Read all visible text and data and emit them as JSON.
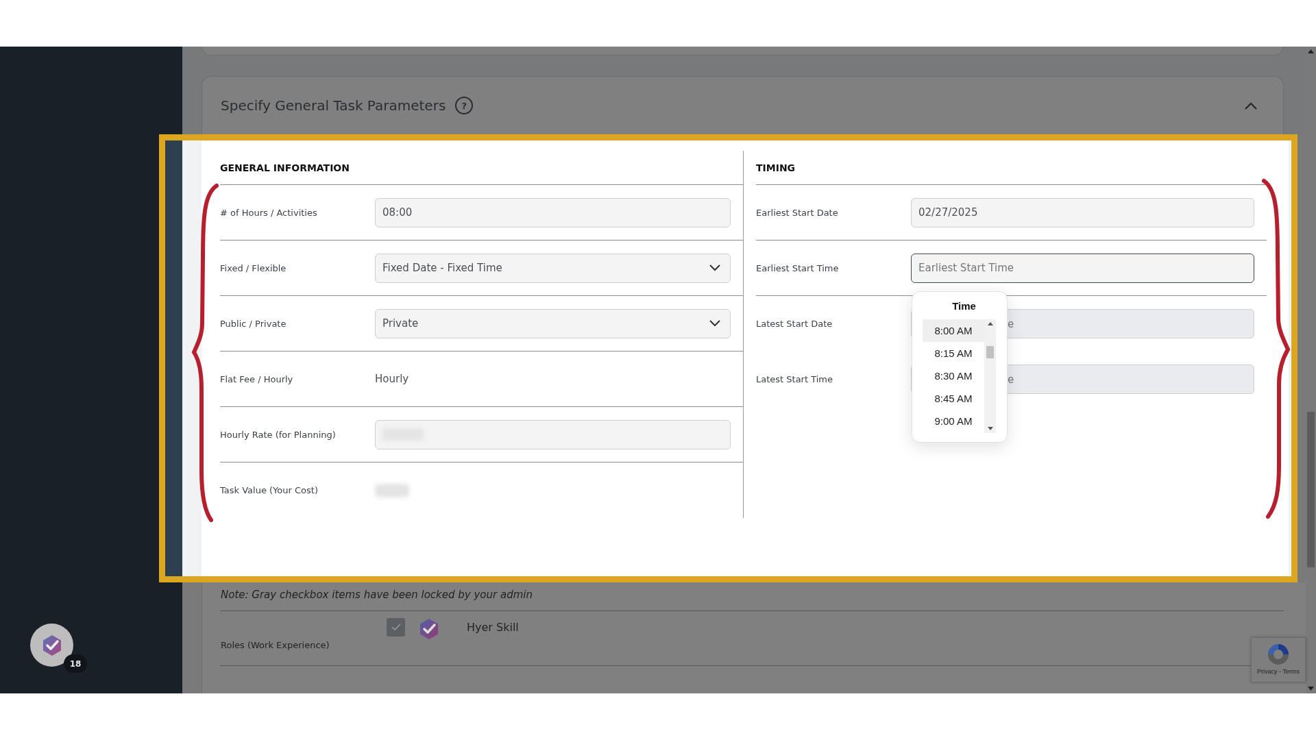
{
  "section": {
    "title": "Specify General Task Parameters",
    "help": "?",
    "expanded": true
  },
  "general": {
    "heading": "GENERAL INFORMATION",
    "rows": [
      {
        "kind": "input",
        "label": "# of Hours / Activities",
        "value": "08:00"
      },
      {
        "kind": "select",
        "label": "Fixed / Flexible",
        "value": "Fixed Date - Fixed Time"
      },
      {
        "kind": "select",
        "label": "Public / Private",
        "value": "Private"
      },
      {
        "kind": "text",
        "label": "Flat Fee / Hourly",
        "value": "Hourly"
      },
      {
        "kind": "hidden-input",
        "label": "Hourly Rate (for Planning)"
      },
      {
        "kind": "hidden-text",
        "label": "Task Value (Your Cost)"
      }
    ]
  },
  "timing": {
    "heading": "TIMING",
    "rows": [
      {
        "kind": "input",
        "label": "Earliest Start Date",
        "value": "02/27/2025"
      },
      {
        "kind": "picker",
        "label": "Earliest Start Time",
        "placeholder": "Earliest Start Time"
      },
      {
        "kind": "covered",
        "label": "Latest Start Date",
        "placeholder": "e"
      },
      {
        "kind": "covered",
        "label": "Latest Start Time",
        "placeholder": "e"
      }
    ]
  },
  "time_picker": {
    "title": "Time",
    "options": [
      {
        "label": "8:00 AM",
        "selected": true
      },
      {
        "label": "8:15 AM",
        "selected": false
      },
      {
        "label": "8:30 AM",
        "selected": false
      },
      {
        "label": "8:45 AM",
        "selected": false
      },
      {
        "label": "9:00 AM",
        "selected": false
      }
    ]
  },
  "requirements": {
    "note": "Note: Gray checkbox items have been locked by your admin",
    "rows": [
      {
        "label": "Roles (Work Experience)",
        "items": [
          {
            "name": "Hyer Skill",
            "checked": true,
            "locked": true
          }
        ]
      }
    ]
  },
  "sidebar": {
    "badge": "18"
  },
  "recaptcha": {
    "links": "Privacy - Terms"
  }
}
